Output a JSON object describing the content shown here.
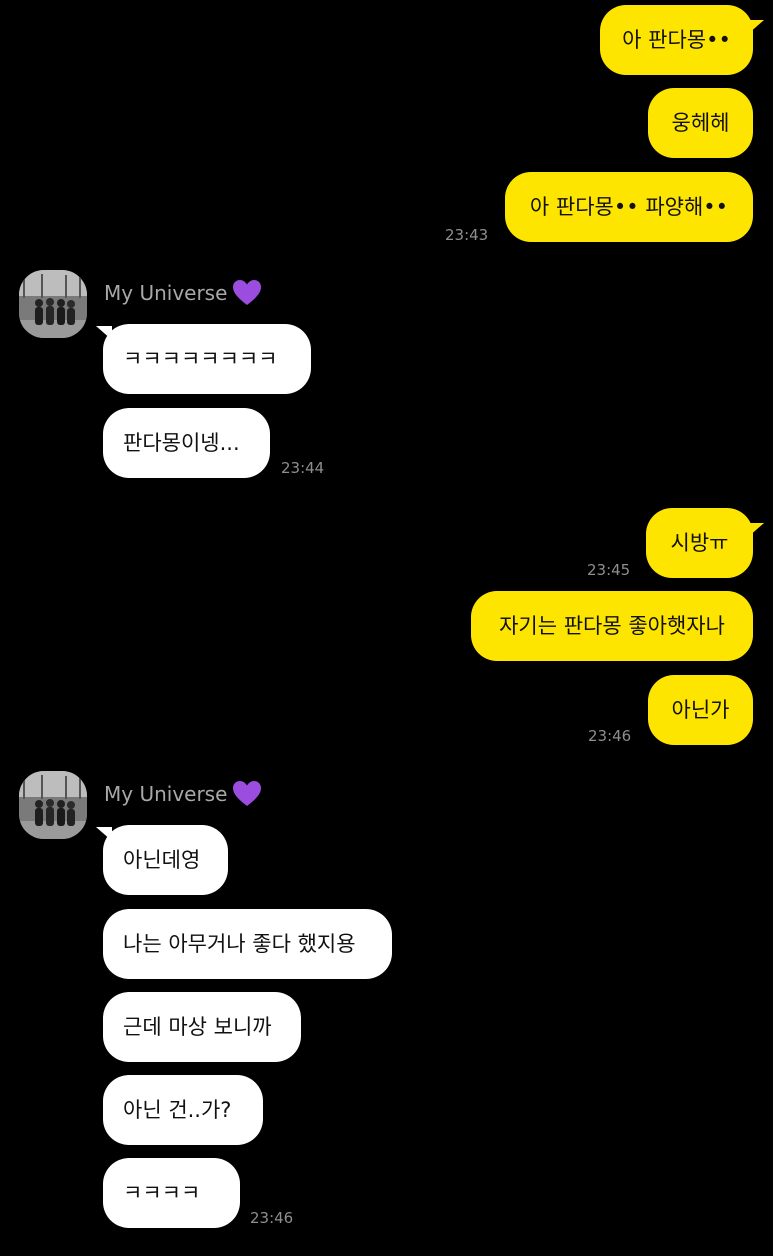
{
  "sender": {
    "name": "My Universe",
    "name_icon": "purple-heart-icon",
    "avatar_icon": "group-photo-avatar"
  },
  "messages": {
    "m1": {
      "text": "아 판다몽••"
    },
    "m2": {
      "text": "웅헤헤"
    },
    "m3": {
      "text": "아 판다몽•• 파양해••",
      "time": "23:43"
    },
    "m4": {
      "text": "ㅋㅋㅋㅋㅋㅋㅋㅋ"
    },
    "m5": {
      "text": "판다몽이넹...",
      "time": "23:44"
    },
    "m6": {
      "text": "시방ㅠ",
      "time": "23:45"
    },
    "m7": {
      "text": "자기는 판다몽 좋아햇자나"
    },
    "m8": {
      "text": "아닌가",
      "time": "23:46"
    },
    "m9": {
      "text": "아닌데영"
    },
    "m10": {
      "text": "나는 아무거나 좋다 했지용"
    },
    "m11": {
      "text": "근데 마상 보니까"
    },
    "m12": {
      "text": "아닌 건..가?"
    },
    "m13": {
      "text": "ㅋㅋㅋㅋ",
      "time": "23:46"
    }
  },
  "colors": {
    "background": "#000000",
    "my_bubble": "#FEE500",
    "their_bubble": "#FFFFFF",
    "timestamp": "#8E8E8E",
    "sender_name": "#A8A8A8",
    "heart": "#9B4DE0"
  }
}
